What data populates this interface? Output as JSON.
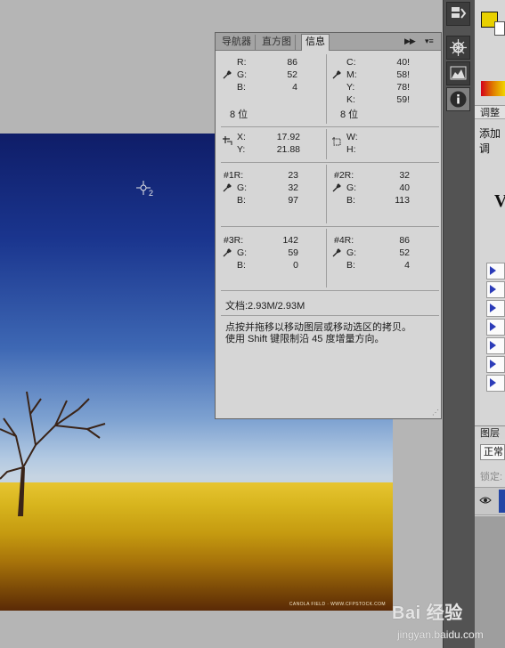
{
  "tabs": [
    {
      "label": "导航器",
      "active": false
    },
    {
      "label": "直方图",
      "active": false
    },
    {
      "label": "信息",
      "active": true
    }
  ],
  "info": {
    "rgb": {
      "r_label": "R:",
      "g_label": "G:",
      "b_label": "B:",
      "r": "86",
      "g": "52",
      "b": "4",
      "bits": "8 位"
    },
    "cmyk": {
      "c_label": "C:",
      "m_label": "M:",
      "y_label": "Y:",
      "k_label": "K:",
      "c": "40!",
      "m": "58!",
      "y": "78!",
      "k": "59!",
      "bits": "8 位"
    },
    "position": {
      "x_label": "X:",
      "y_label": "Y:",
      "x": "17.92",
      "y": "21.88"
    },
    "size": {
      "w_label": "W:",
      "h_label": "H:"
    },
    "samplers": [
      {
        "r_label": "#1R:",
        "g_label": "G:",
        "b_label": "B:",
        "r": "23",
        "g": "32",
        "b": "97"
      },
      {
        "r_label": "#2R:",
        "g_label": "G:",
        "b_label": "B:",
        "r": "32",
        "g": "40",
        "b": "113"
      },
      {
        "r_label": "#3R:",
        "g_label": "G:",
        "b_label": "B:",
        "r": "142",
        "g": "59",
        "b": "0"
      },
      {
        "r_label": "#4R:",
        "g_label": "G:",
        "b_label": "B:",
        "r": "86",
        "g": "52",
        "b": "4"
      }
    ],
    "document": "文档:2.93M/2.93M",
    "hint_line1": "点按并拖移以移动图层或移动选区的拷贝。",
    "hint_line2": "使用 Shift 键限制沿 45 度增量方向。"
  },
  "cursor_sampler_number": "2",
  "photo_credit": "CANOLA FIELD · WWW.CFPSTOCK.COM",
  "right_panels": {
    "adjustments_header": "调整",
    "adjustments_add": "添加调",
    "layers_header": "图层",
    "blend_mode": "正常",
    "lock_label": "锁定:"
  },
  "watermark": {
    "logo": "Bai 经验",
    "sub": "jingyan.baidu.com"
  },
  "colors": {
    "foreground": "#e8d000",
    "panel_bg": "#d6d6d6",
    "dock_bg": "#535353"
  }
}
